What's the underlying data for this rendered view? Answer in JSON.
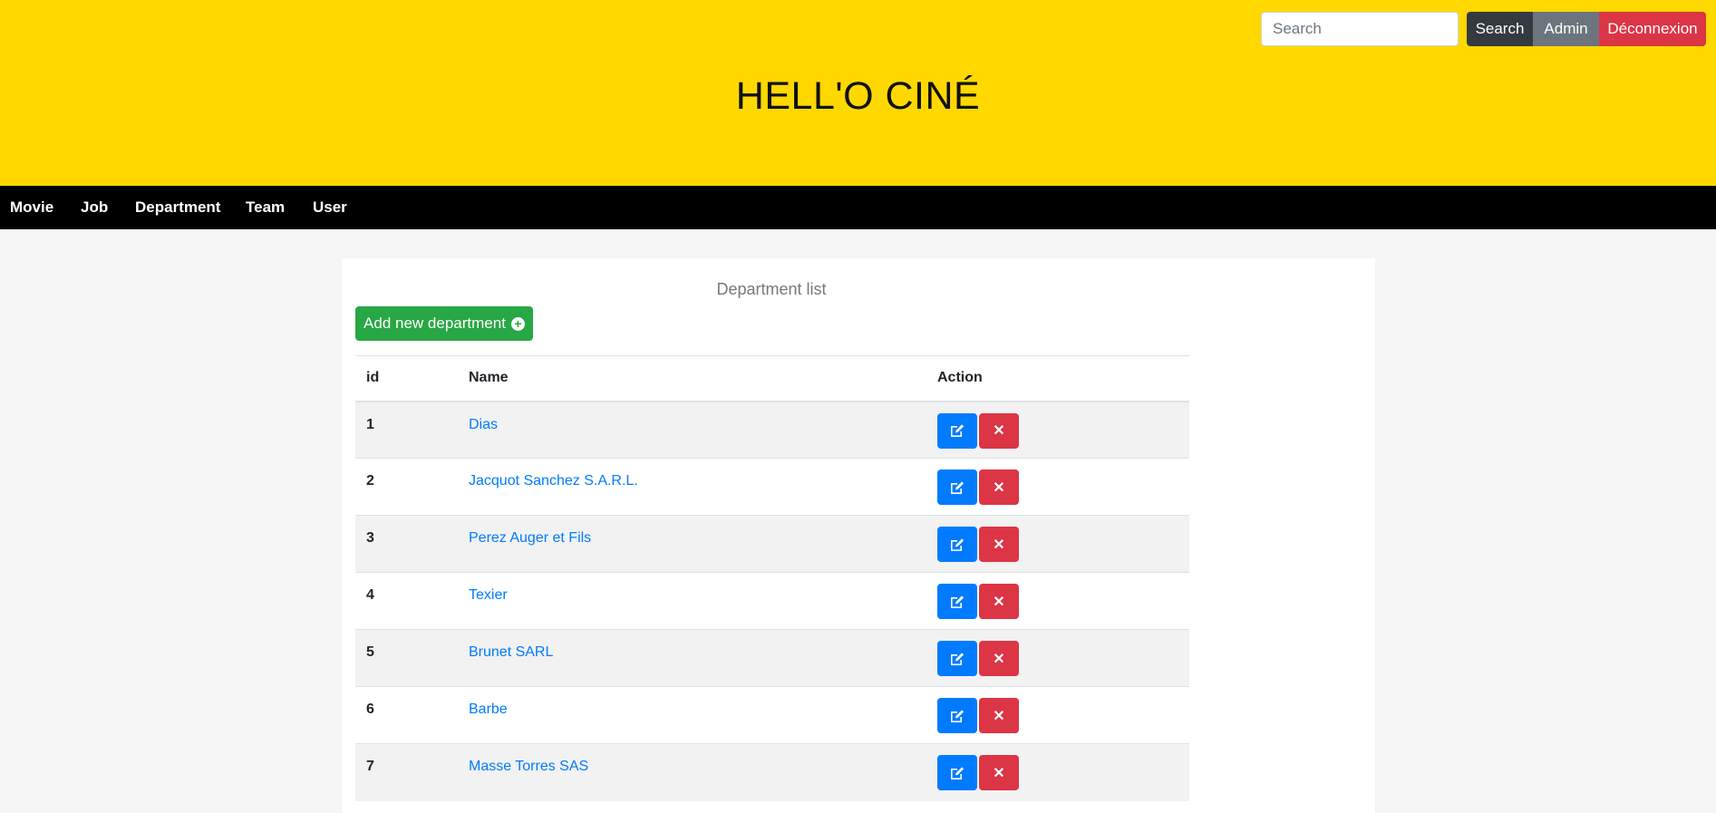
{
  "header": {
    "title": "HELL'O CINÉ",
    "search_placeholder": "Search",
    "search_button": "Search",
    "admin_button": "Admin",
    "logout_button": "Déconnexion"
  },
  "nav": {
    "items": [
      "Movie",
      "Job",
      "Department",
      "Team",
      "User"
    ]
  },
  "main": {
    "title": "Department list",
    "add_button": "Add new department",
    "columns": [
      "id",
      "Name",
      "Action"
    ],
    "rows": [
      {
        "id": "1",
        "name": "Dias"
      },
      {
        "id": "2",
        "name": "Jacquot Sanchez S.A.R.L."
      },
      {
        "id": "3",
        "name": "Perez Auger et Fils"
      },
      {
        "id": "4",
        "name": "Texier"
      },
      {
        "id": "5",
        "name": "Brunet SARL"
      },
      {
        "id": "6",
        "name": "Barbe"
      },
      {
        "id": "7",
        "name": "Masse Torres SAS"
      }
    ],
    "icons": {
      "edit": "edit-icon",
      "delete": "close-icon",
      "add": "plus-circle-icon"
    }
  },
  "colors": {
    "header_bg": "#ffd800",
    "nav_bg": "#000000",
    "primary": "#007bff",
    "danger": "#dc3545",
    "success": "#28a745",
    "dark": "#343a40",
    "secondary": "#6c757d"
  }
}
